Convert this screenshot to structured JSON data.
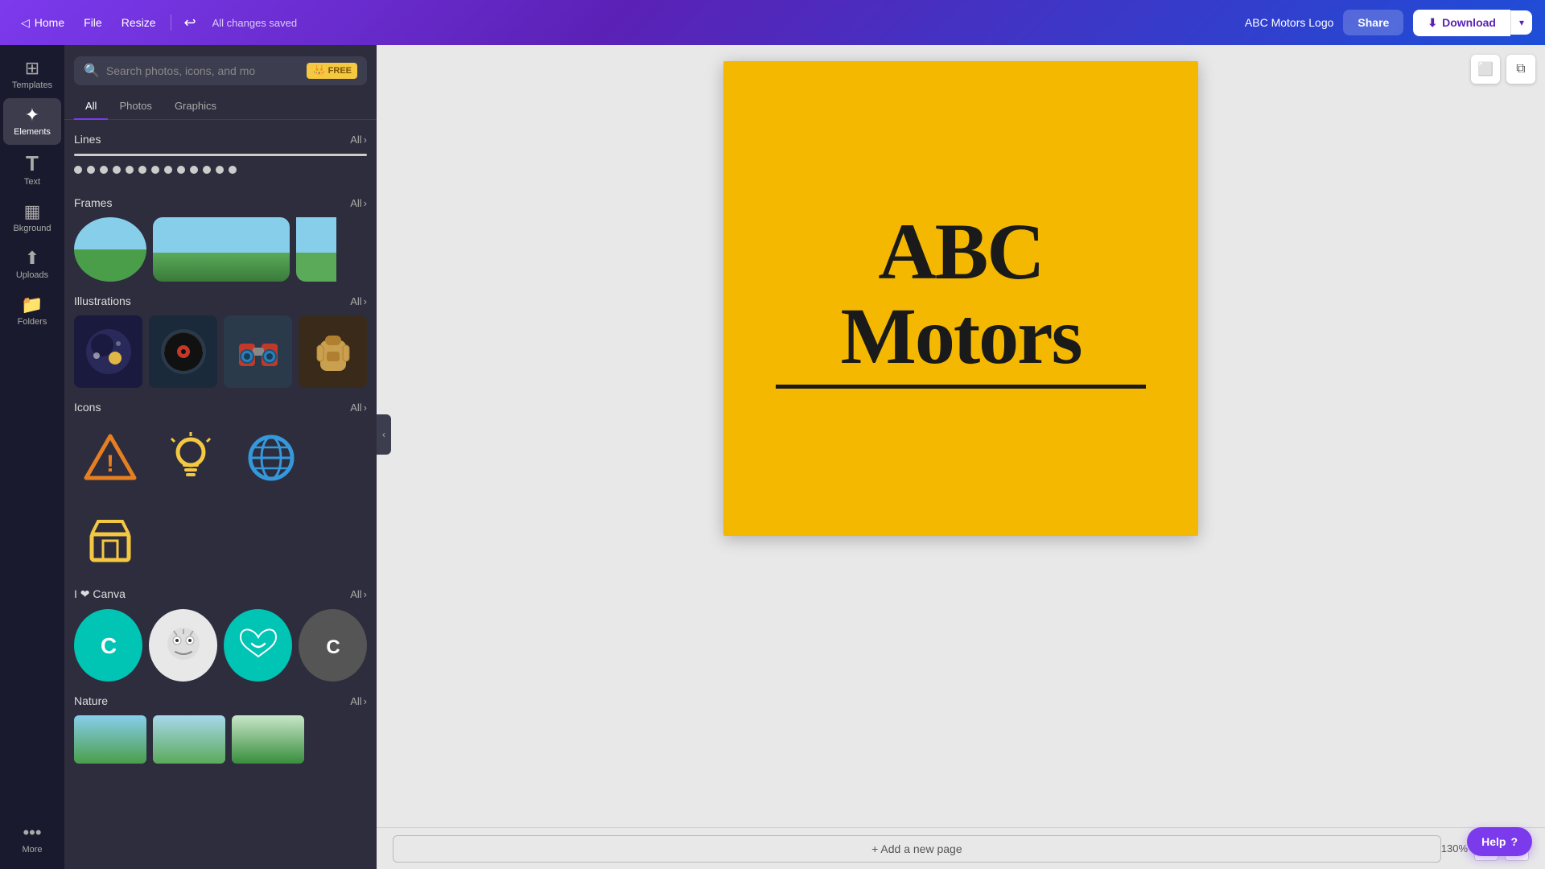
{
  "topbar": {
    "home_label": "Home",
    "file_label": "File",
    "resize_label": "Resize",
    "saved_text": "All changes saved",
    "doc_name": "ABC Motors Logo",
    "share_label": "Share",
    "download_label": "Download"
  },
  "sidebar": {
    "items": [
      {
        "id": "templates",
        "label": "Templates",
        "icon": "⊞"
      },
      {
        "id": "elements",
        "label": "Elements",
        "icon": "✦"
      },
      {
        "id": "text",
        "label": "Text",
        "icon": "T"
      },
      {
        "id": "background",
        "label": "Bkground",
        "icon": "◻"
      },
      {
        "id": "uploads",
        "label": "Uploads",
        "icon": "⬆"
      },
      {
        "id": "folders",
        "label": "Folders",
        "icon": "📁"
      },
      {
        "id": "more",
        "label": "More",
        "icon": "···"
      }
    ]
  },
  "panel": {
    "search_placeholder": "Search photos, icons, and mo",
    "free_badge": "FREE",
    "tabs": [
      {
        "id": "all",
        "label": "All",
        "active": true
      },
      {
        "id": "photos",
        "label": "Photos"
      },
      {
        "id": "graphics",
        "label": "Graphics"
      }
    ],
    "sections": [
      {
        "id": "lines",
        "title": "Lines",
        "all_label": "All"
      },
      {
        "id": "frames",
        "title": "Frames",
        "all_label": "All"
      },
      {
        "id": "illustrations",
        "title": "Illustrations",
        "all_label": "All"
      },
      {
        "id": "icons",
        "title": "Icons",
        "all_label": "All"
      },
      {
        "id": "i-love-canva",
        "title": "I ❤ Canva",
        "all_label": "All"
      },
      {
        "id": "nature",
        "title": "Nature",
        "all_label": "All"
      }
    ]
  },
  "canvas": {
    "text_line1": "ABC",
    "text_line2": "Motors",
    "add_page_label": "+ Add a new page",
    "zoom_level": "130%"
  },
  "toolbar": {
    "help_label": "Help"
  }
}
